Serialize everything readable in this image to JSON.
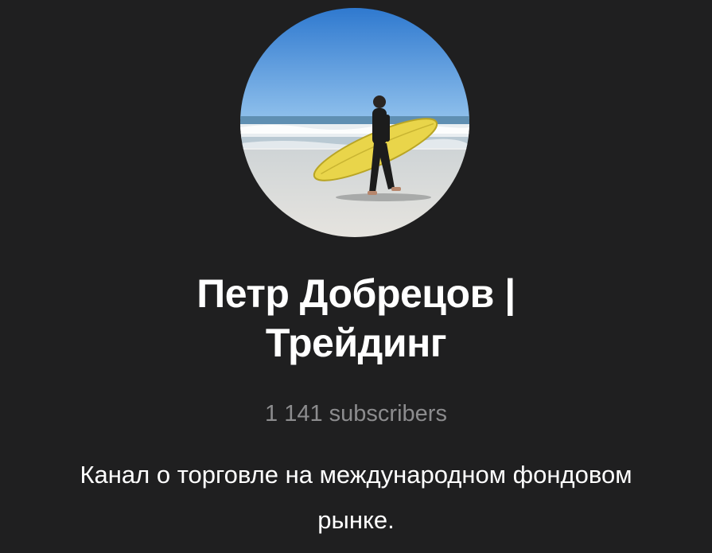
{
  "channel": {
    "title_line1": "Петр Добрецов |",
    "title_line2": "Трейдинг",
    "subscribers": "1 141 subscribers",
    "description_line1": "Канал о торговле на международном фондовом",
    "description_line2": "рынке."
  },
  "colors": {
    "background": "#1f1f20",
    "title": "#ffffff",
    "subscribers": "#8c8c8e",
    "description": "#ffffff"
  },
  "icons": {
    "avatar": "surfer-photo"
  }
}
